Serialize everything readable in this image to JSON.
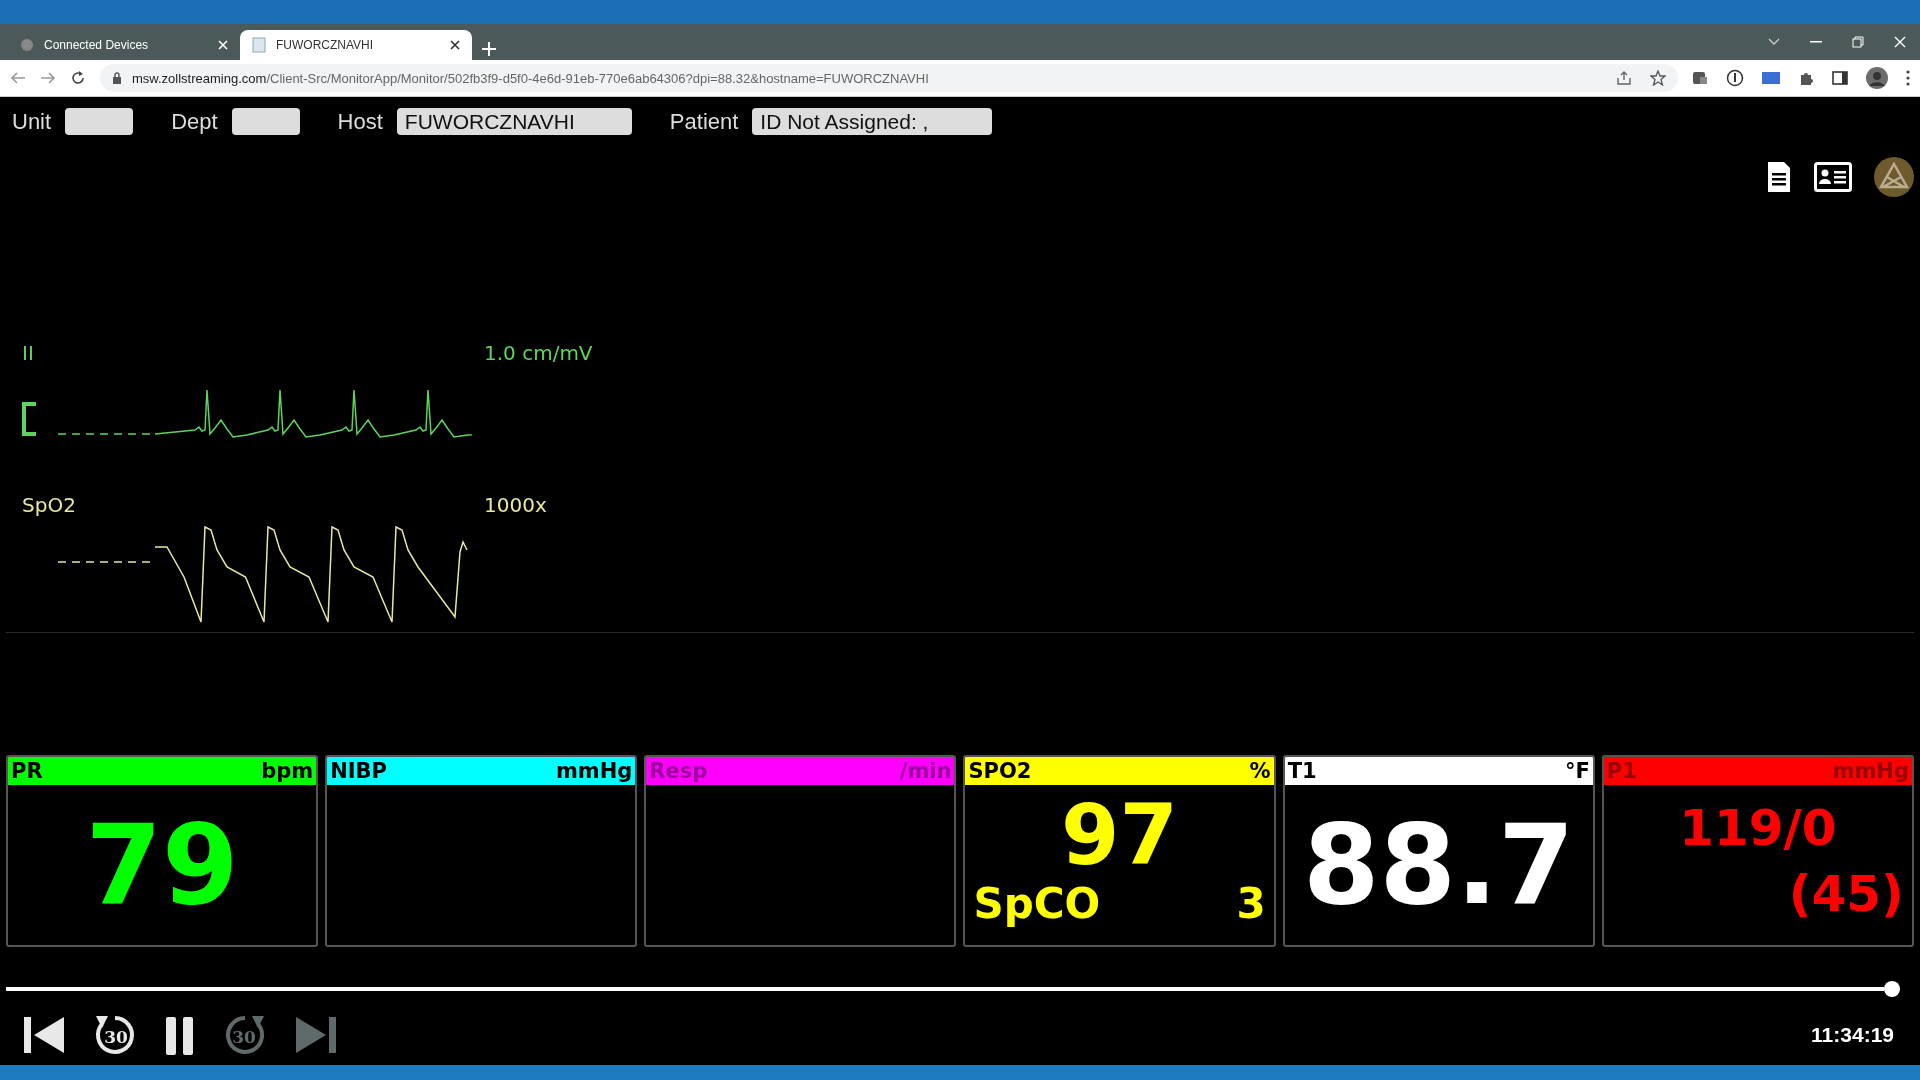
{
  "browser": {
    "tabs": [
      {
        "title": "Connected Devices",
        "selected": false
      },
      {
        "title": "FUWORCZNAVHI",
        "selected": true
      }
    ],
    "address": {
      "domain": "msw.zollstreaming.com",
      "path": "/Client-Src/MonitorApp/Monitor/502fb3f9-d5f0-4e6d-91eb-770e6ab64306?dpi=88.32&hostname=FUWORCZNAVHI"
    }
  },
  "header": {
    "fields": [
      {
        "label": "Unit"
      },
      {
        "label": "Dept"
      },
      {
        "label": "Host",
        "value": "FUWORCZNAVHI"
      },
      {
        "label": "Patient",
        "value": "ID Not Assigned: ,"
      }
    ]
  },
  "waveforms": [
    {
      "kind": "ecg",
      "label": "II",
      "scale": "1.0 cm/mV",
      "color": "#5fd35f"
    },
    {
      "kind": "pleth",
      "label": "SpO2",
      "scale": "1000x",
      "color": "#e8e8a0"
    }
  ],
  "tiles": [
    {
      "kind": "single",
      "label": "PR",
      "unit": "bpm",
      "color": "#00ff00",
      "dimmed": false,
      "value": "79"
    },
    {
      "kind": "empty",
      "label": "NIBP",
      "unit": "mmHg",
      "color": "#00ffff",
      "dimmed": false
    },
    {
      "kind": "empty",
      "label": "Resp",
      "unit": "/min",
      "color": "#ff00ff",
      "dimmed": true
    },
    {
      "kind": "spo2",
      "label": "SPO2",
      "unit": "%",
      "color": "#ffff00",
      "dimmed": false,
      "value": "97",
      "sub_label": "SpCO",
      "sub_value": "3"
    },
    {
      "kind": "single",
      "label": "T1",
      "unit": "°F",
      "color": "#ffffff",
      "dimmed": false,
      "value": "88.7"
    },
    {
      "kind": "pressure",
      "label": "P1",
      "unit": "mmHg",
      "color": "#ff0000",
      "dimmed": true,
      "value": "119/0",
      "mean": "(45)"
    }
  ],
  "playback": {
    "level": 1,
    "time": "11:34:19",
    "controls": [
      {
        "kind": "start",
        "disabled": false
      },
      {
        "kind": "rewind",
        "label": "30",
        "disabled": false
      },
      {
        "kind": "pause",
        "disabled": false
      },
      {
        "kind": "forward",
        "label": "30",
        "disabled": true
      },
      {
        "kind": "end",
        "disabled": true
      }
    ]
  }
}
